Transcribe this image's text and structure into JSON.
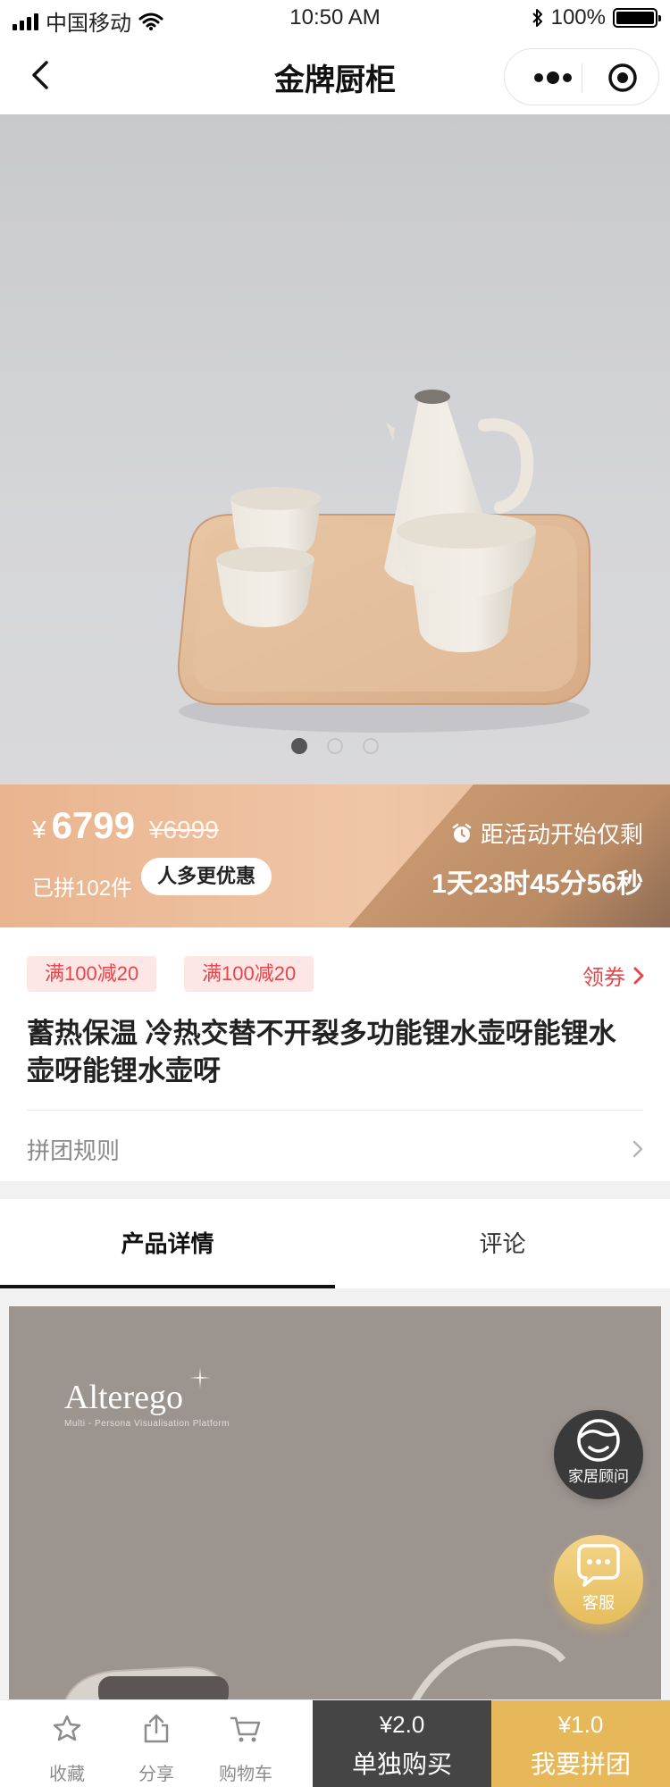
{
  "status_bar": {
    "carrier": "中国移动",
    "time": "10:50 AM",
    "battery": "100%"
  },
  "nav": {
    "title": "金牌厨柜"
  },
  "hero": {
    "image_count": 3,
    "active_index": 0
  },
  "promo": {
    "currency": "¥",
    "price": "6799",
    "original_price": "¥6999",
    "joined": "已拼102件",
    "badge": "人多更优惠",
    "countdown_label": "距活动开始仅剩",
    "countdown": "1天23时45分56秒"
  },
  "coupons": {
    "items": [
      "满100减20",
      "满100减20"
    ],
    "get_label": "领券"
  },
  "product": {
    "title": "蓄热保温 冷热交替不开裂多功能锂水壶呀能锂水壶呀能锂水壶呀"
  },
  "rules": {
    "label": "拼团规则"
  },
  "tabs": {
    "items": [
      "产品详情",
      "评论"
    ],
    "active": 0
  },
  "detail": {
    "brand": "Alterego",
    "brand_sub": "Multi - Persona Visualisation Platform"
  },
  "floating": {
    "advisor_label": "家居顾问",
    "service_label": "客服"
  },
  "bottom_bar": {
    "favorite": "收藏",
    "share": "分享",
    "cart": "购物车",
    "single_price": "¥2.0",
    "single_label": "单独购买",
    "group_price": "¥1.0",
    "group_label": "我要拼团"
  },
  "colors": {
    "accent_red": "#e5464b",
    "gold": "#e7b85a",
    "dark": "#454545",
    "promo_peach": "#eebf9c"
  }
}
